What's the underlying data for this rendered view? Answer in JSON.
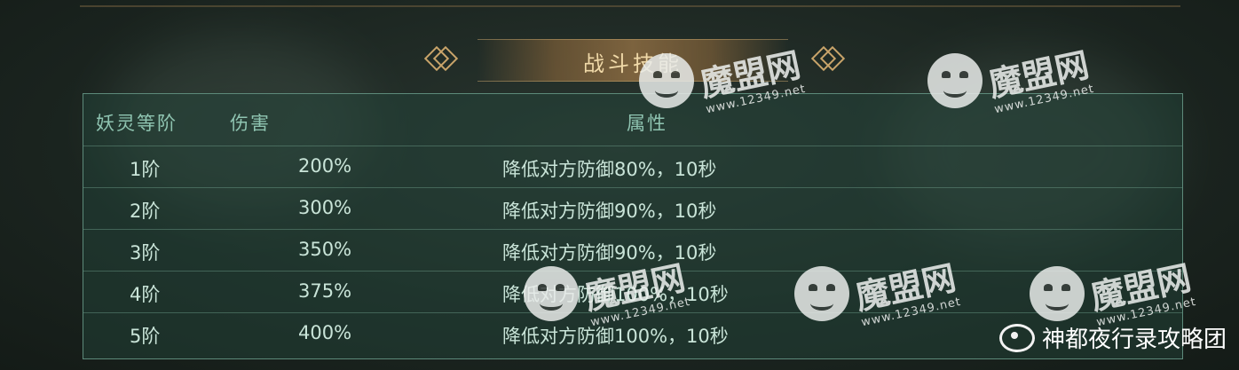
{
  "panel": {
    "title": "战斗技能",
    "headers": {
      "rank": "妖灵等阶",
      "damage": "伤害",
      "attribute": "属性"
    },
    "rows": [
      {
        "rank": "1阶",
        "damage": "200%",
        "attribute": "降低对方防御80%，10秒"
      },
      {
        "rank": "2阶",
        "damage": "300%",
        "attribute": "降低对方防御90%，10秒"
      },
      {
        "rank": "3阶",
        "damage": "350%",
        "attribute": "降低对方防御90%，10秒"
      },
      {
        "rank": "4阶",
        "damage": "375%",
        "attribute": "降低对方防御100%，10秒"
      },
      {
        "rank": "5阶",
        "damage": "400%",
        "attribute": "降低对方防御100%，10秒"
      }
    ]
  },
  "watermark": {
    "brand": "魔盟网",
    "url": "www.12349.net"
  },
  "credit": {
    "text": "神都夜行录攻略团",
    "icon": "weibo-icon"
  },
  "colors": {
    "accent": "#c9a46a",
    "table_border": "#5d8a7a",
    "header_text": "#8fc4b1",
    "cell_text": "#c9e4d8"
  }
}
